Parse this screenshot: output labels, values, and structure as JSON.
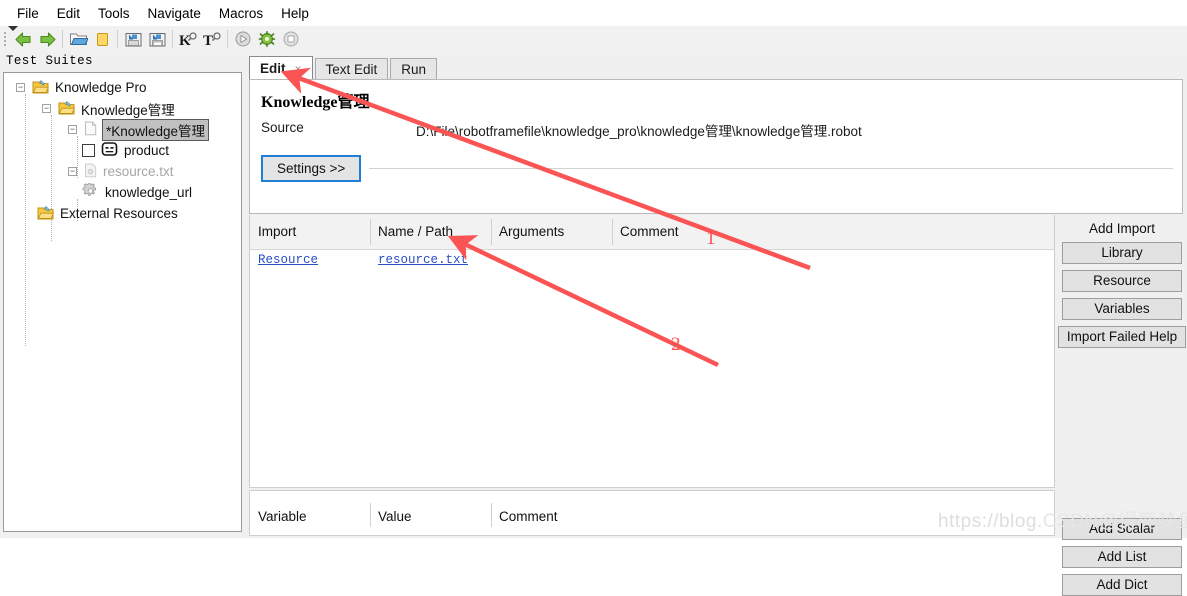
{
  "menu": {
    "items": [
      "File",
      "Edit",
      "Tools",
      "Navigate",
      "Macros",
      "Help"
    ]
  },
  "toolbar": {
    "buttons": [
      {
        "name": "back-icon",
        "label": "Back"
      },
      {
        "name": "forward-icon",
        "label": "Forward"
      },
      {
        "name": "open-folder-icon",
        "label": "Open Directory"
      },
      {
        "name": "new-file-icon",
        "label": "New File"
      },
      {
        "name": "save-icon",
        "label": "Save"
      },
      {
        "name": "save-all-icon",
        "label": "Save All"
      },
      {
        "name": "search-keyword-icon",
        "label": "K"
      },
      {
        "name": "search-test-icon",
        "label": "T"
      },
      {
        "name": "run-icon",
        "label": "Run"
      },
      {
        "name": "debug-icon",
        "label": "Debug"
      },
      {
        "name": "stop-icon",
        "label": "Stop"
      }
    ]
  },
  "sidebar": {
    "title": "Test Suites",
    "items": [
      {
        "label": "Knowledge Pro",
        "icon": "suite-folder-icon",
        "depth": 0,
        "expander": "-",
        "dim": false,
        "selected": false,
        "checkbox": false
      },
      {
        "label": "Knowledge管理",
        "icon": "suite-folder-icon",
        "depth": 1,
        "expander": "-",
        "dim": false,
        "selected": false,
        "checkbox": false
      },
      {
        "label": "*Knowledge管理",
        "icon": "file-icon",
        "depth": 2,
        "expander": "-",
        "dim": false,
        "selected": true,
        "checkbox": false
      },
      {
        "label": "product",
        "icon": "robot-test-icon",
        "depth": 3,
        "expander": "",
        "dim": false,
        "selected": false,
        "checkbox": true
      },
      {
        "label": "resource.txt",
        "icon": "resource-icon",
        "depth": 2,
        "expander": "-",
        "dim": true,
        "selected": false,
        "checkbox": false
      },
      {
        "label": "knowledge_url",
        "icon": "gear-icon",
        "depth": 3,
        "expander": "",
        "dim": false,
        "selected": false,
        "checkbox": false
      },
      {
        "label": "External Resources",
        "icon": "suite-folder-icon",
        "depth": 1,
        "expander": "",
        "dim": false,
        "selected": false,
        "checkbox": false
      }
    ]
  },
  "editor": {
    "tabs": [
      {
        "label": "Edit",
        "active": true,
        "closable": true,
        "close_glyph": "×"
      },
      {
        "label": "Text Edit",
        "active": false,
        "closable": false
      },
      {
        "label": "Run",
        "active": false,
        "closable": false
      }
    ],
    "doc_title": "Knowledge管理",
    "source_label": "Source",
    "source_value": "D:\\File\\robotframefile\\knowledge_pro\\knowledge管理\\knowledge管理.robot",
    "settings_button": "Settings >>"
  },
  "imports_table": {
    "headers": [
      "Import",
      "Name / Path",
      "Arguments",
      "Comment"
    ],
    "rows": [
      {
        "import": "Resource",
        "name_path": "resource.txt",
        "arguments": "",
        "comment": ""
      }
    ]
  },
  "variables_table": {
    "headers": [
      "Variable",
      "Value",
      "Comment"
    ],
    "rows": []
  },
  "right_panel": {
    "add_import_title": "Add Import",
    "import_buttons": [
      "Library",
      "Resource",
      "Variables",
      "Import Failed Help"
    ],
    "variable_buttons": [
      "Add Scalar",
      "Add List",
      "Add Dict"
    ]
  },
  "annotations": {
    "arrow1_number": "1",
    "arrow2_number": "2",
    "color": "#fb5454"
  },
  "watermark": {
    "url": "https://blog.",
    "brand": "CSDN",
    "author": "@得鹿梦鱼"
  },
  "colors": {
    "accent_blue": "#1f7fd4",
    "link_blue": "#2b4fc4",
    "annotation_red": "#fb5454",
    "panel_gray": "#f0f0f0"
  }
}
